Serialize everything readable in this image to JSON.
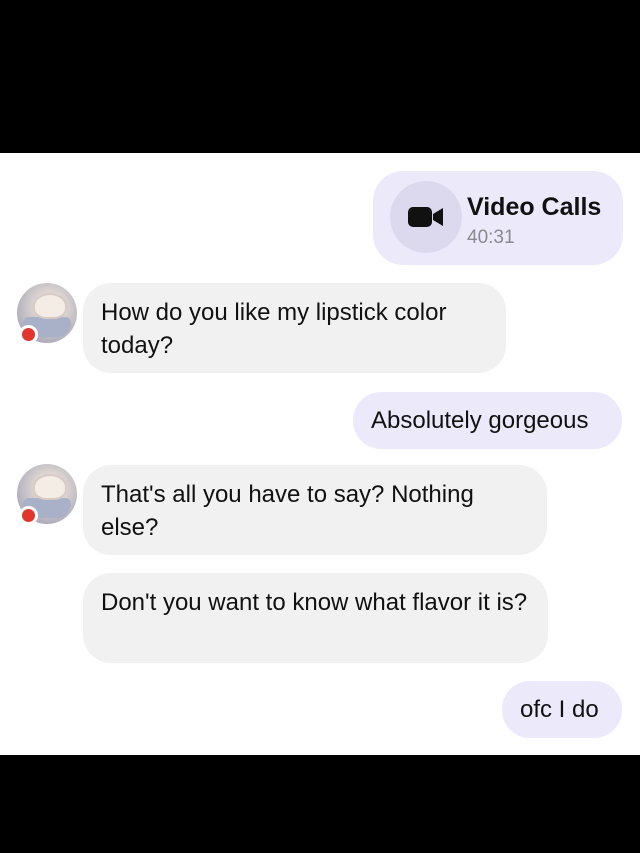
{
  "video_call": {
    "title": "Video Calls",
    "duration": "40:31",
    "icon": "video-camera-icon"
  },
  "messages": [
    {
      "direction": "incoming",
      "text": "How do you like my lipstick color today?"
    },
    {
      "direction": "outgoing",
      "text": "Absolutely gorgeous"
    },
    {
      "direction": "incoming",
      "text": "That's all you have to say? Nothing else?"
    },
    {
      "direction": "incoming",
      "text": "Don't you want to know what flavor it is?"
    },
    {
      "direction": "outgoing",
      "text": "ofc I do"
    }
  ],
  "colors": {
    "outgoing_bubble": "#ece9fb",
    "incoming_bubble": "#f1f1f2",
    "status_dot": "#e0362f"
  }
}
